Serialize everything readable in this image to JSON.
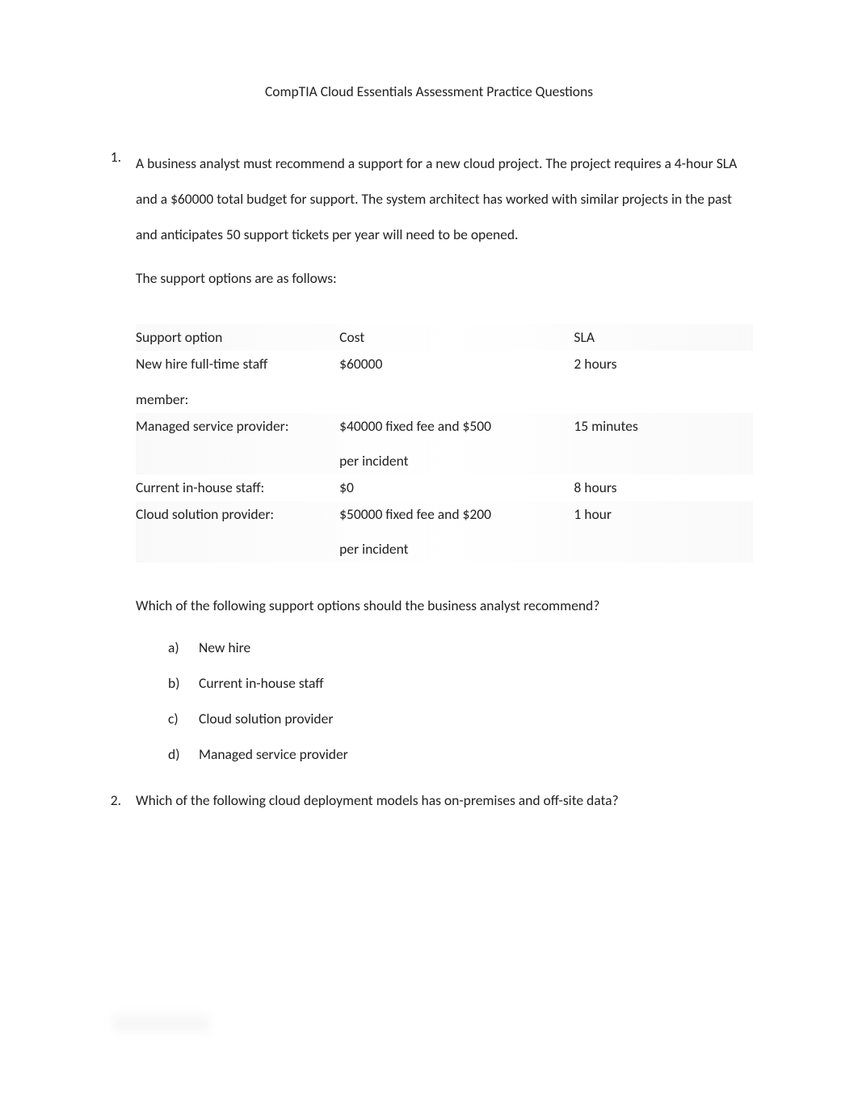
{
  "title": "CompTIA Cloud Essentials Assessment Practice Questions",
  "q1": {
    "number": "1.",
    "text": "A business analyst must recommend a support for a new cloud project. The project requires a 4-hour SLA and a $60000 total budget for support. The system architect has worked with similar projects in the past and anticipates 50 support tickets per year will need to be opened.",
    "intro": "The support options are as follows:",
    "table": {
      "headers": {
        "col1": "Support option",
        "col2": "Cost",
        "col3": "SLA"
      },
      "rows": [
        {
          "option": "New hire full-time staff member:",
          "cost": "$60000",
          "sla": "2 hours"
        },
        {
          "option": "Managed service provider:",
          "cost": "$40000 fixed fee and $500 per incident",
          "sla": "15 minutes"
        },
        {
          "option": "Current in-house staff:",
          "cost": "$0",
          "sla": "8 hours"
        },
        {
          "option": "Cloud solution provider:",
          "cost": "$50000 fixed fee and $200 per incident",
          "sla": "1 hour"
        }
      ]
    },
    "followup": "Which of the following support options should the business analyst recommend?",
    "options": [
      {
        "letter": "a)",
        "text": "New hire"
      },
      {
        "letter": "b)",
        "text": "Current in-house staff"
      },
      {
        "letter": "c)",
        "text": "Cloud solution provider"
      },
      {
        "letter": "d)",
        "text": "Managed service provider"
      }
    ]
  },
  "q2": {
    "number": "2.",
    "text": "Which of the following cloud deployment models has on-premises and off-site data?"
  }
}
